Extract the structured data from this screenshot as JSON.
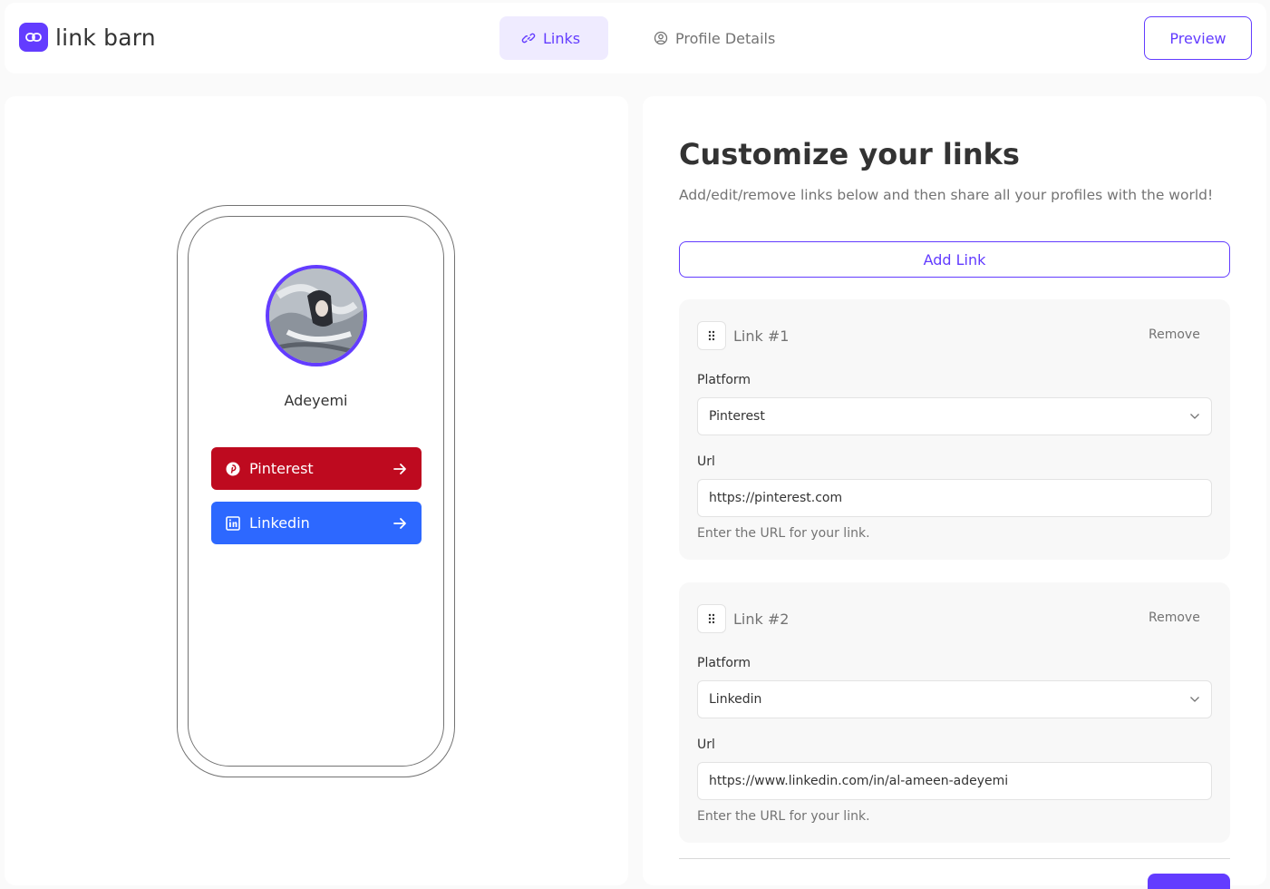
{
  "header": {
    "brand": "link barn",
    "tabs": [
      {
        "label": "Links",
        "icon": "link-icon",
        "active": true
      },
      {
        "label": "Profile Details",
        "icon": "user-circle-icon",
        "active": false
      }
    ],
    "preview_label": "Preview"
  },
  "preview": {
    "name": "Adeyemi",
    "links": [
      {
        "label": "Pinterest",
        "icon": "pinterest-icon",
        "color": "#be0a1f"
      },
      {
        "label": "Linkedin",
        "icon": "linkedin-icon",
        "color": "#2d68ff"
      }
    ]
  },
  "editor": {
    "title": "Customize your links",
    "subtitle": "Add/edit/remove links below and then share all your profiles with the world!",
    "add_label": "Add Link",
    "links": [
      {
        "number_label": "Link #1",
        "remove_label": "Remove",
        "platform_label": "Platform",
        "platform": "Pinterest",
        "url_label": "Url",
        "url": "https://pinterest.com",
        "helper": "Enter the URL for your link."
      },
      {
        "number_label": "Link #2",
        "remove_label": "Remove",
        "platform_label": "Platform",
        "platform": "Linkedin",
        "url_label": "Url",
        "url": "https://www.linkedin.com/in/al-ameen-adeyemi",
        "helper": "Enter the URL for your link."
      }
    ]
  },
  "colors": {
    "accent": "#633cff",
    "accent_light": "#efebff"
  }
}
